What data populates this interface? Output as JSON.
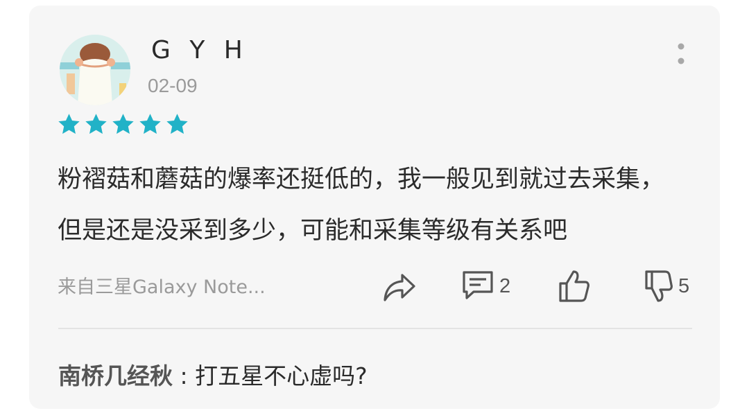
{
  "review": {
    "username": "G Y H",
    "date": "02-09",
    "rating": 5,
    "rating_max": 5,
    "star_color": "#21b2c7",
    "text": "粉褶菇和蘑菇的爆率还挺低的，我一般见到就过去采集，但是还是没采到多少，可能和采集等级有关系吧",
    "device": "来自三星Galaxy Note...",
    "icons": {
      "more": "more-vertical-icon",
      "share": "share-arrow-icon",
      "comment": "comment-icon",
      "like": "thumbs-up-icon",
      "dislike": "thumbs-down-icon"
    }
  },
  "actions": {
    "comment_count": "2",
    "dislike_count": "5"
  },
  "reply": {
    "user": "南桥几经秋",
    "separator": " : ",
    "text": "打五星不心虚吗?"
  }
}
